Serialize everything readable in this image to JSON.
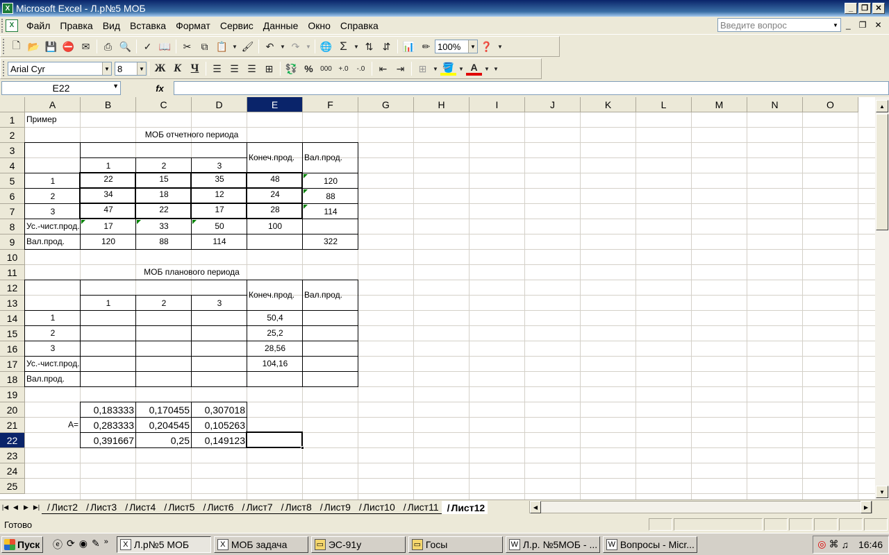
{
  "window": {
    "title": "Microsoft Excel - Л.р№5 МОБ"
  },
  "menu": {
    "items": [
      "Файл",
      "Правка",
      "Вид",
      "Вставка",
      "Формат",
      "Сервис",
      "Данные",
      "Окно",
      "Справка"
    ],
    "ask_placeholder": "Введите вопрос"
  },
  "toolbar": {
    "zoom": "100%",
    "font": "Arial Cyr",
    "size": "8",
    "bold": "Ж",
    "italic": "К",
    "underline": "Ч",
    "percent": "%",
    "thousands": "000"
  },
  "formula_bar": {
    "name_box": "E22",
    "fx": "fx",
    "value": ""
  },
  "columns": [
    "A",
    "B",
    "C",
    "D",
    "E",
    "F",
    "G",
    "H",
    "I",
    "J",
    "K",
    "L",
    "M",
    "N",
    "O"
  ],
  "rows": [
    "1",
    "2",
    "3",
    "4",
    "5",
    "6",
    "7",
    "8",
    "9",
    "10",
    "11",
    "12",
    "13",
    "14",
    "15",
    "16",
    "17",
    "18",
    "19",
    "20",
    "21",
    "22",
    "23",
    "24",
    "25"
  ],
  "selected": {
    "col": "E",
    "row": "22"
  },
  "cells": {
    "A1": "Пример",
    "T1": "МОБ отчетного периода",
    "E3": "Конеч.прод.",
    "F3": "Вал.прод.",
    "B4": "1",
    "C4": "2",
    "D4": "3",
    "A5": "1",
    "B5": "22",
    "C5": "15",
    "D5": "35",
    "E5": "48",
    "F5": "120",
    "A6": "2",
    "B6": "34",
    "C6": "18",
    "D6": "12",
    "E6": "24",
    "F6": "88",
    "A7": "3",
    "B7": "47",
    "C7": "22",
    "D7": "17",
    "E7": "28",
    "F7": "114",
    "A8": "Ус.-чист.прод.",
    "B8": "17",
    "C8": "33",
    "D8": "50",
    "E8": "100",
    "A9": "Вал.прод.",
    "B9": "120",
    "C9": "88",
    "D9": "114",
    "F9": "322",
    "T2": "МОБ планового периода",
    "E12": "Конеч.прод.",
    "F12": "Вал.прод.",
    "B13": "1",
    "C13": "2",
    "D13": "3",
    "A14": "1",
    "E14": "50,4",
    "A15": "2",
    "E15": "25,2",
    "A16": "3",
    "E16": "28,56",
    "A17": "Ус.-чист.прод.",
    "E17": "104,16",
    "A18": "Вал.прод.",
    "A21": "A=",
    "B20": "0,183333",
    "C20": "0,170455",
    "D20": "0,307018",
    "B21": "0,283333",
    "C21": "0,204545",
    "D21": "0,105263",
    "B22": "0,391667",
    "C22": "0,25",
    "D22": "0,149123"
  },
  "sheets": [
    "Лист2",
    "Лист3",
    "Лист4",
    "Лист5",
    "Лист6",
    "Лист7",
    "Лист8",
    "Лист9",
    "Лист10",
    "Лист11",
    "Лист12"
  ],
  "active_sheet": "Лист12",
  "status": {
    "text": "Готово"
  },
  "taskbar": {
    "start": "Пуск",
    "tasks": [
      "Л.р№5 МОБ",
      "МОБ задача",
      "ЭС-91у",
      "Госы",
      "Л.р. №5МОБ - ...",
      "Вопросы - Micr..."
    ],
    "clock": "16:46"
  }
}
